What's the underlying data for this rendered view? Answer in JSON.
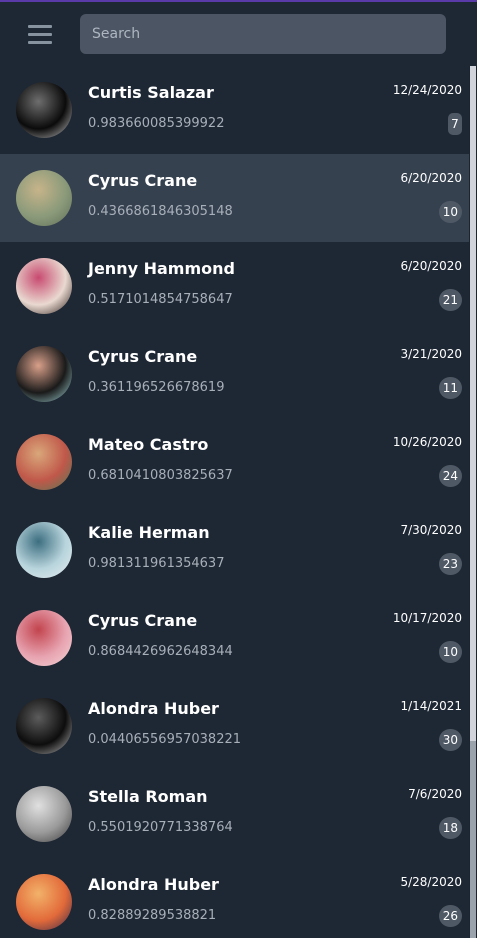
{
  "search": {
    "placeholder": "Search"
  },
  "contacts": [
    {
      "name": "Curtis Salazar",
      "value": "0.983660085399922",
      "date": "12/24/2020",
      "count": "7",
      "avatar_colors": [
        "#0b0b0b",
        "#6e6e6e",
        "#c8c8c8"
      ]
    },
    {
      "name": "Cyrus Crane",
      "value": "0.4366861846305148",
      "date": "6/20/2020",
      "count": "10",
      "avatar_colors": [
        "#8a9a7a",
        "#c7b48a",
        "#5f6e56"
      ]
    },
    {
      "name": "Jenny Hammond",
      "value": "0.5171014854758647",
      "date": "6/20/2020",
      "count": "21",
      "avatar_colors": [
        "#e9d9d0",
        "#c84a70",
        "#2a1c1a"
      ]
    },
    {
      "name": "Cyrus Crane",
      "value": "0.361196526678619",
      "date": "3/21/2020",
      "count": "11",
      "avatar_colors": [
        "#1a1a1a",
        "#d9a08a",
        "#a6dadc"
      ]
    },
    {
      "name": "Mateo Castro",
      "value": "0.6810410803825637",
      "date": "10/26/2020",
      "count": "24",
      "avatar_colors": [
        "#c0584a",
        "#d9a77a",
        "#4f7a54"
      ]
    },
    {
      "name": "Kalie Herman",
      "value": "0.981311961354637",
      "date": "7/30/2020",
      "count": "23",
      "avatar_colors": [
        "#b8d4dc",
        "#3c6e80",
        "#e6eef0"
      ]
    },
    {
      "name": "Cyrus Crane",
      "value": "0.8684426962648344",
      "date": "10/17/2020",
      "count": "10",
      "avatar_colors": [
        "#e7a3b0",
        "#c2444e",
        "#f3d6d8"
      ]
    },
    {
      "name": "Alondra Huber",
      "value": "0.04406556957038221",
      "date": "1/14/2021",
      "count": "30",
      "avatar_colors": [
        "#0d0d0d",
        "#5c5c5c",
        "#bdbdbd"
      ]
    },
    {
      "name": "Stella Roman",
      "value": "0.5501920771338764",
      "date": "7/6/2020",
      "count": "18",
      "avatar_colors": [
        "#9a9a9a",
        "#e0e0e0",
        "#3a3a3a"
      ]
    },
    {
      "name": "Alondra Huber",
      "value": "0.82889289538821",
      "date": "5/28/2020",
      "count": "26",
      "avatar_colors": [
        "#e26a3a",
        "#f2b26a",
        "#3a2a4a"
      ]
    }
  ],
  "selected_index": 1
}
